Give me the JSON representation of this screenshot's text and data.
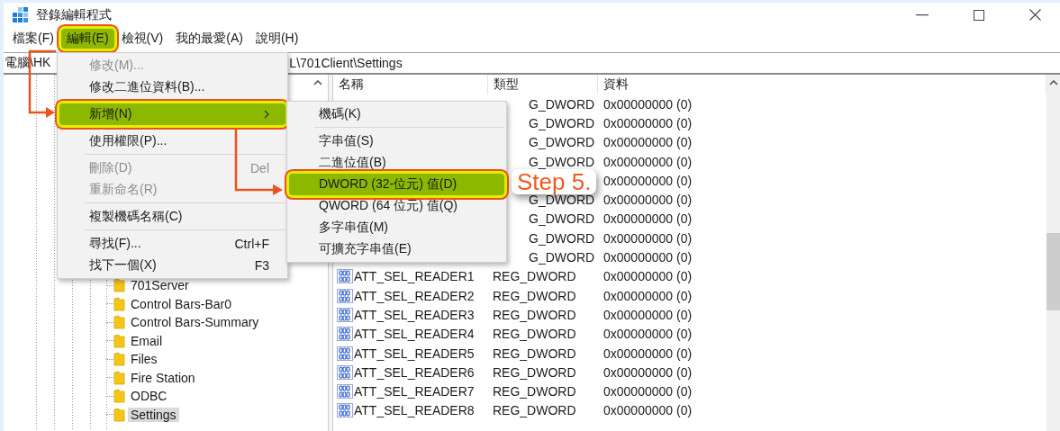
{
  "window": {
    "title": "登錄編輯程式"
  },
  "menu_bar": [
    {
      "label": "檔案(F)",
      "selected": false
    },
    {
      "label": "編輯(E)",
      "selected": true
    },
    {
      "label": "檢視(V)",
      "selected": false
    },
    {
      "label": "我的最愛(A)",
      "selected": false
    },
    {
      "label": "說明(H)",
      "selected": false
    }
  ],
  "address_bar": {
    "value_start": "電腦\\HK",
    "value_end": "L\\701Client\\Settings"
  },
  "edit_menu": [
    {
      "kind": "item",
      "label": "修改(M)...",
      "disabled": true,
      "selected": false
    },
    {
      "kind": "item",
      "label": "修改二進位資料(B)...",
      "disabled": false,
      "selected": false
    },
    {
      "kind": "separator"
    },
    {
      "kind": "submenu",
      "label": "新增(N)",
      "disabled": false,
      "selected": true
    },
    {
      "kind": "separator"
    },
    {
      "kind": "item",
      "label": "使用權限(P)...",
      "disabled": false,
      "selected": false
    },
    {
      "kind": "separator"
    },
    {
      "kind": "item",
      "label": "刪除(D)",
      "shortcut": "Del",
      "disabled": true,
      "selected": false
    },
    {
      "kind": "item",
      "label": "重新命名(R)",
      "disabled": true,
      "selected": false
    },
    {
      "kind": "separator"
    },
    {
      "kind": "item",
      "label": "複製機碼名稱(C)",
      "disabled": false,
      "selected": false
    },
    {
      "kind": "separator"
    },
    {
      "kind": "item",
      "label": "尋找(F)...",
      "shortcut": "Ctrl+F",
      "disabled": false,
      "selected": false
    },
    {
      "kind": "item",
      "label": "找下一個(X)",
      "shortcut": "F3",
      "disabled": false,
      "selected": false
    }
  ],
  "new_submenu": [
    {
      "kind": "item",
      "label": "機碼(K)",
      "selected": false
    },
    {
      "kind": "separator"
    },
    {
      "kind": "item",
      "label": "字串值(S)",
      "selected": false
    },
    {
      "kind": "item",
      "label": "二進位值(B)",
      "selected": false
    },
    {
      "kind": "item",
      "label": "DWORD (32-位元) 值(D)",
      "selected": true
    },
    {
      "kind": "item",
      "label": "QWORD (64 位元) 值(Q)",
      "selected": false
    },
    {
      "kind": "item",
      "label": "多字串值(M)",
      "selected": false
    },
    {
      "kind": "item",
      "label": "可擴充字串值(E)",
      "selected": false
    }
  ],
  "tree": {
    "items": [
      {
        "label": "701Server",
        "selected": false
      },
      {
        "label": "Control Bars-Bar0",
        "selected": false
      },
      {
        "label": "Control Bars-Summary",
        "selected": false
      },
      {
        "label": "Email",
        "selected": false
      },
      {
        "label": "Files",
        "selected": false
      },
      {
        "label": "Fire Station",
        "selected": false
      },
      {
        "label": "ODBC",
        "selected": false
      },
      {
        "label": "Settings",
        "selected": true
      }
    ]
  },
  "list": {
    "columns": [
      "名稱",
      "類型",
      "資料"
    ],
    "rows": [
      {
        "type": "G_DWORD",
        "data": "0x00000000 (0)"
      },
      {
        "type": "G_DWORD",
        "data": "0x00000000 (0)"
      },
      {
        "type": "G_DWORD",
        "data": "0x00000000 (0)"
      },
      {
        "type": "G_DWORD",
        "data": "0x00000000 (0)"
      },
      {
        "data": "0x00000000 (0)"
      },
      {
        "type": "G_DWORD",
        "data": "0x00000000 (0)"
      },
      {
        "type": "G_DWORD",
        "data": "0x00000000 (0)"
      },
      {
        "type": "G_DWORD",
        "data": "0x00000000 (0)"
      },
      {
        "type": "G_DWORD",
        "data": "0x00000000 (0)"
      },
      {
        "kind": "dword",
        "name": "ATT_SEL_READER1",
        "type": "REG_DWORD",
        "data": "0x00000000 (0)"
      },
      {
        "kind": "dword",
        "name": "ATT_SEL_READER2",
        "type": "REG_DWORD",
        "data": "0x00000000 (0)"
      },
      {
        "kind": "dword",
        "name": "ATT_SEL_READER3",
        "type": "REG_DWORD",
        "data": "0x00000000 (0)"
      },
      {
        "kind": "dword",
        "name": "ATT_SEL_READER4",
        "type": "REG_DWORD",
        "data": "0x00000000 (0)"
      },
      {
        "kind": "dword",
        "name": "ATT_SEL_READER5",
        "type": "REG_DWORD",
        "data": "0x00000000 (0)"
      },
      {
        "kind": "dword",
        "name": "ATT_SEL_READER6",
        "type": "REG_DWORD",
        "data": "0x00000000 (0)"
      },
      {
        "kind": "dword",
        "name": "ATT_SEL_READER7",
        "type": "REG_DWORD",
        "data": "0x00000000 (0)"
      },
      {
        "kind": "dword",
        "name": "ATT_SEL_READER8",
        "type": "REG_DWORD",
        "data": "0x00000000 (0)"
      }
    ]
  },
  "annotation": {
    "label": "Step 5."
  }
}
